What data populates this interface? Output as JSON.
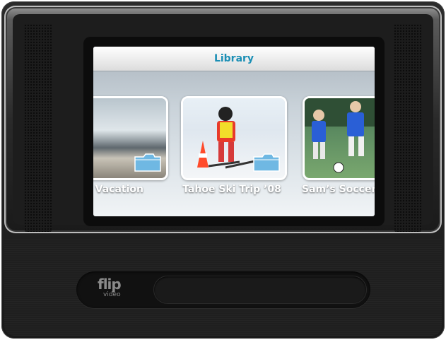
{
  "screen": {
    "title": "Library",
    "albums": [
      {
        "label": "ily Vacation",
        "icon": "folder-icon"
      },
      {
        "label": "Tahoe Ski Trip ’08",
        "icon": "folder-icon"
      },
      {
        "label": "Sam’s Soccer G",
        "icon": "folder-icon"
      }
    ]
  },
  "device": {
    "logo_main": "flip",
    "logo_sub": "video"
  },
  "colors": {
    "title_text": "#1b8fb5",
    "device_body": "#1f1f1f"
  }
}
